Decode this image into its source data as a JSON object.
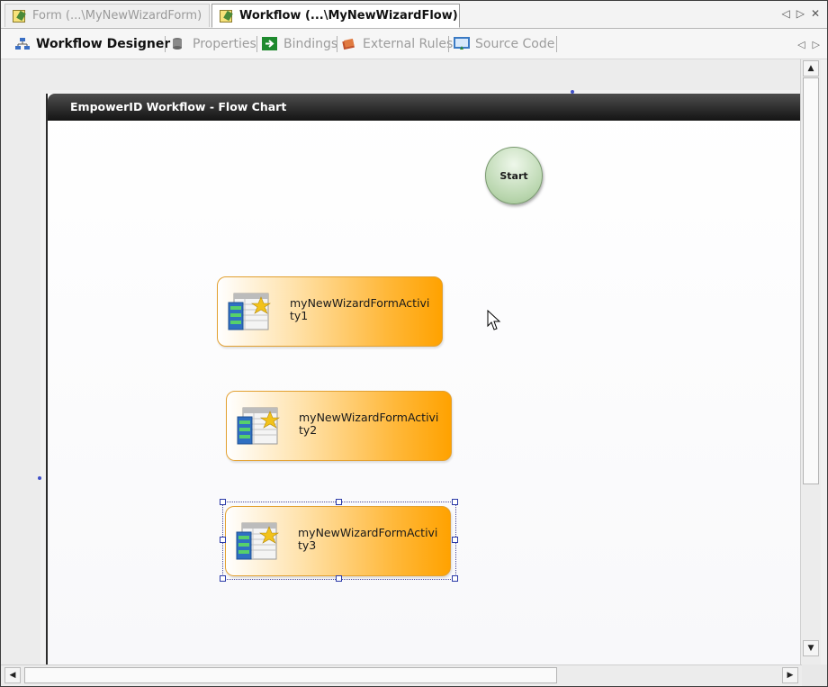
{
  "doc_tabs": [
    {
      "label": "Form (...\\MyNewWizardForm)",
      "active": false
    },
    {
      "label": "Workflow (...\\MyNewWizardFlow)",
      "active": true
    }
  ],
  "doc_nav": {
    "prev": "◁",
    "next": "▷",
    "close": "✕"
  },
  "view_tabs": [
    {
      "label": "Workflow Designer",
      "selected": true
    },
    {
      "label": "Properties",
      "selected": false
    },
    {
      "label": "Bindings",
      "selected": false
    },
    {
      "label": "External Rules",
      "selected": false
    },
    {
      "label": "Source Code",
      "selected": false
    }
  ],
  "view_nav": {
    "prev": "◁",
    "next": "▷"
  },
  "flowchart": {
    "title": "EmpowerID Workflow - Flow Chart",
    "start_label": "Start",
    "activities": [
      {
        "label": "myNewWizardFormActivity1",
        "selected": false
      },
      {
        "label": "myNewWizardFormActivity2",
        "selected": false
      },
      {
        "label": "myNewWizardFormActivity3",
        "selected": true
      }
    ]
  },
  "scroll": {
    "up": "▲",
    "down": "▼",
    "left": "◀",
    "right": "▶"
  },
  "colors": {
    "activity_accent": "#ffa200",
    "header_bg": "#1e1e1e",
    "start_fill": "#b9d6ae",
    "selection": "#2b3aa8"
  },
  "icons": {
    "activity": "form-activity-icon",
    "designer": "designer-tree-icon"
  }
}
